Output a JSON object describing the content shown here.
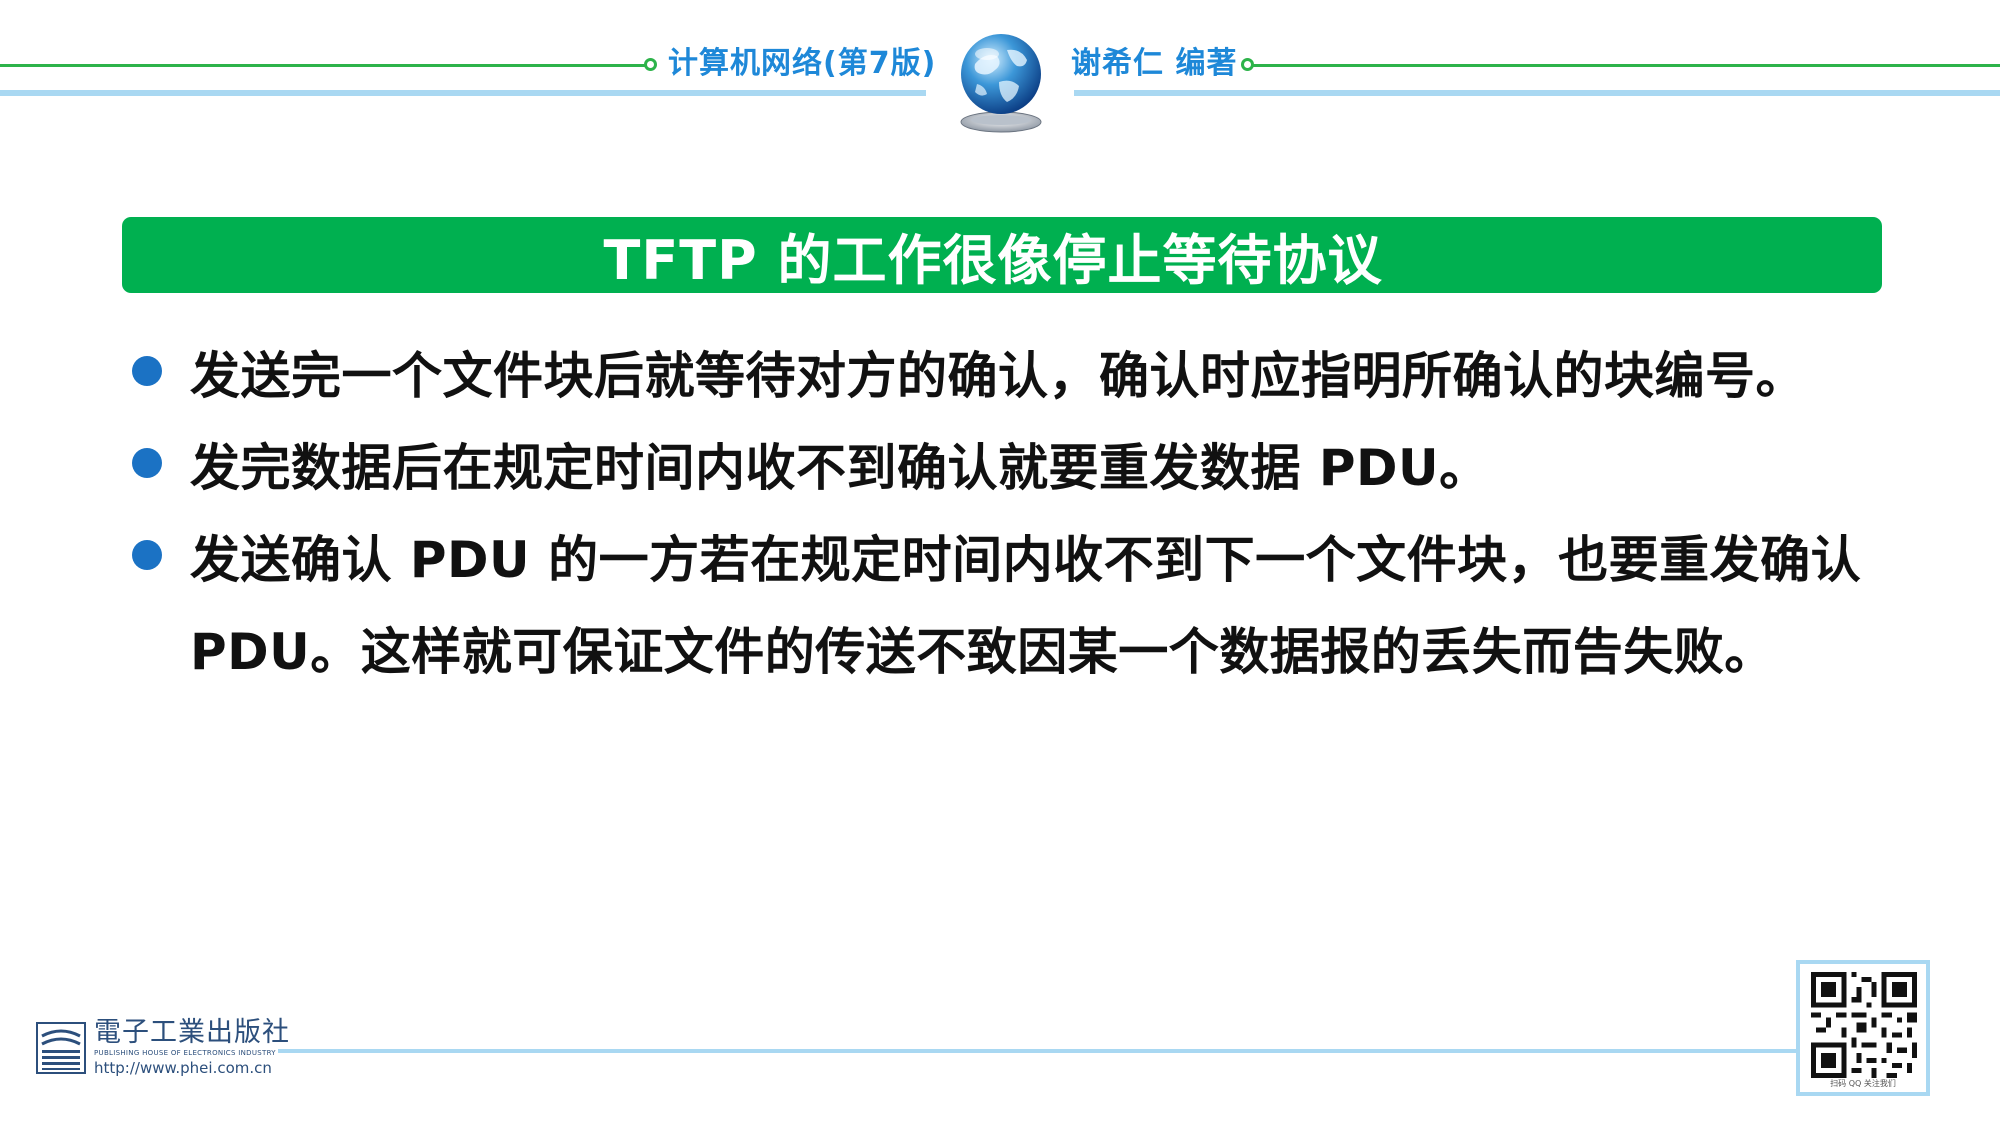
{
  "header": {
    "book_title": "计算机网络(第7版)",
    "author": "谢希仁 编著",
    "globe_icon": "globe-icon"
  },
  "title": "TFTP 的工作很像停止等待协议",
  "bullets": [
    "发送完一个文件块后就等待对方的确认，确认时应指明所确认的块编号。",
    "发完数据后在规定时间内收不到确认就要重发数据 PDU。",
    "发送确认 PDU 的一方若在规定时间内收不到下一个文件块，也要重发确认 PDU。这样就可保证文件的传送不致因某一个数据报的丢失而告失败。"
  ],
  "footer": {
    "publisher_name": "電子工業出版社",
    "publisher_english": "PUBLISHING HOUSE OF ELECTRONICS INDUSTRY",
    "publisher_url": "http://www.phei.com.cn",
    "qr_caption": "扫码 QQ 关注我们"
  },
  "colors": {
    "header_green": "#2db34a",
    "header_blue": "#1e88d8",
    "title_bar": "#00b050",
    "bullet_dot": "#1b72c4",
    "divider_blue": "#a9d8f2"
  }
}
